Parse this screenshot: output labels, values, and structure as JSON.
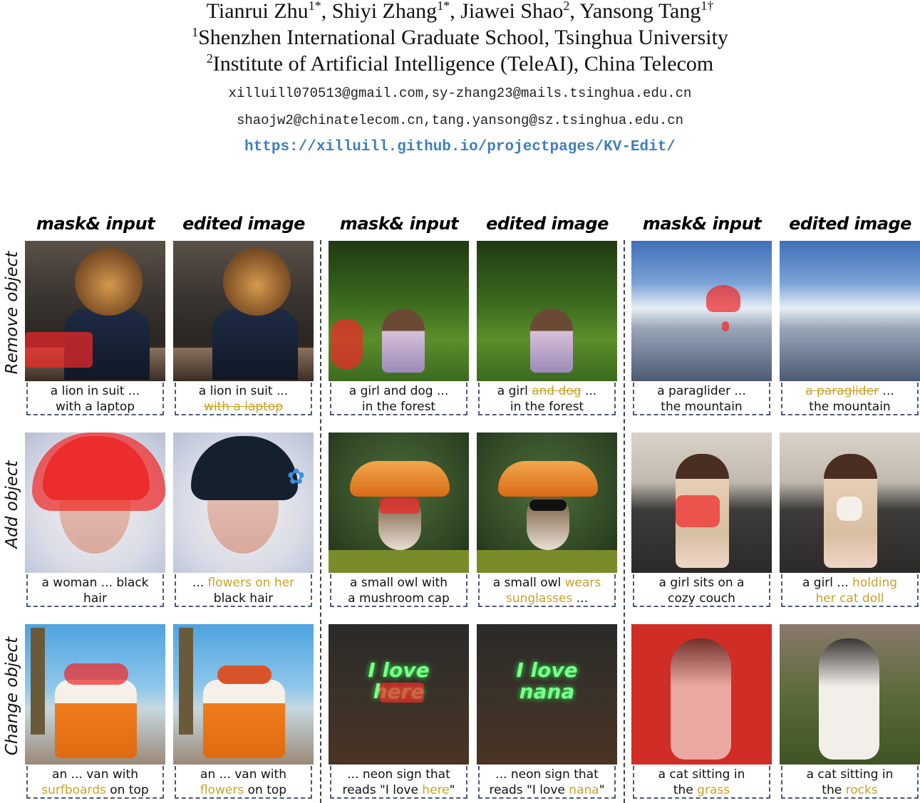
{
  "header": {
    "authors": "Tianrui Zhu1*, Shiyi Zhang1*, Jiawei Shao2, Yansong Tang1†",
    "affiliation1": "1Shenzhen International Graduate School, Tsinghua University",
    "affiliation2": "2Institute of Artificial Intelligence (TeleAI), China Telecom",
    "emails_line1": "xilluill070513@gmail.com,sy-zhang23@mails.tsinghua.edu.cn",
    "emails_line2": "shaojw2@chinatelecom.cn,tang.yansong@sz.tsinghua.edu.cn",
    "url": "https://xilluill.github.io/projectpages/KV-Edit/"
  },
  "columns": {
    "mask_input": "mask& input",
    "edited_image": "edited image"
  },
  "rows": {
    "remove": "Remove object",
    "add": "Add object",
    "change": "Change object"
  },
  "captions": {
    "r1c1": {
      "l1": "a lion in suit ...",
      "l2": "with a laptop"
    },
    "r1c2": {
      "l1": "a lion in suit ...",
      "l2s": "with a laptop"
    },
    "r1c3": {
      "l1": "a girl and dog ...",
      "l2": "in the forest"
    },
    "r1c4": {
      "a": "a girl ",
      "s": "and dog",
      "b": " ...",
      "l2": "in the forest"
    },
    "r1c5": {
      "l1": "a paraglider ...",
      "l2": "the mountain"
    },
    "r1c6": {
      "s": "a paraglider",
      "b": " ...",
      "l2": "the mountain"
    },
    "r2c1": {
      "l1": "a woman ... black",
      "l2": "hair"
    },
    "r2c2": {
      "a": "... ",
      "h": "flowers on her",
      "l2": "black hair"
    },
    "r2c3": {
      "l1": "a small owl with",
      "l2": "a mushroom cap"
    },
    "r2c4": {
      "a": "a small owl ",
      "h": "wears",
      "h2": "sunglasses",
      "b": " ..."
    },
    "r2c5": {
      "l1": "a girl sits on a",
      "l2": "cozy couch"
    },
    "r2c6": {
      "a": "a girl ... ",
      "h": "holding",
      "h2": "her cat doll"
    },
    "r3c1": {
      "l1": "an ... van with",
      "h": "surfboards",
      "b": " on top"
    },
    "r3c2": {
      "l1": "an ... van with",
      "h": "flowers",
      "b": " on top"
    },
    "r3c3": {
      "l1": "... neon sign that",
      "a": "reads \"I love ",
      "h": "here",
      "b": "\""
    },
    "r3c4": {
      "l1": "... neon sign that",
      "a": "reads \"I love ",
      "h": "nana",
      "b": "\""
    },
    "r3c5": {
      "l1": "a cat sitting in",
      "a": "the ",
      "h": "grass"
    },
    "r3c6": {
      "l1": "a cat sitting in",
      "a": "the ",
      "h": "rocks"
    }
  },
  "neon": {
    "mask_text": "I love",
    "mask_word": "here",
    "edit_text": "I love",
    "edit_word": "nana"
  },
  "colors": {
    "highlight": "#c9a227",
    "mask": "#f02828",
    "url": "#3f7fbf"
  }
}
